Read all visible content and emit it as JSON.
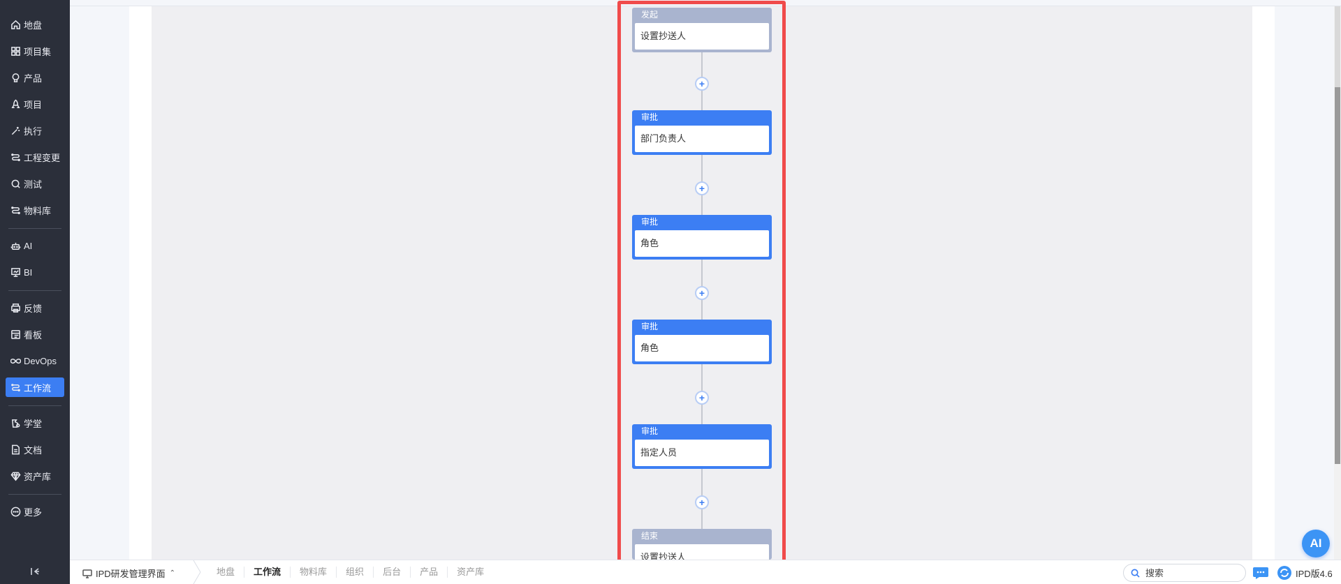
{
  "sidebar": {
    "items": [
      {
        "label": "地盘",
        "icon": "home-icon"
      },
      {
        "label": "项目集",
        "icon": "grid-icon"
      },
      {
        "label": "产品",
        "icon": "lightbulb-icon"
      },
      {
        "label": "项目",
        "icon": "rocket-icon"
      },
      {
        "label": "执行",
        "icon": "wand-icon"
      },
      {
        "label": "工程变更",
        "icon": "flow-icon"
      },
      {
        "label": "测试",
        "icon": "search-circle-icon"
      },
      {
        "label": "物料库",
        "icon": "flow-icon"
      },
      {
        "label": "AI",
        "icon": "robot-icon"
      },
      {
        "label": "BI",
        "icon": "chart-board-icon"
      },
      {
        "label": "反馈",
        "icon": "printer-icon"
      },
      {
        "label": "看板",
        "icon": "board-icon"
      },
      {
        "label": "DevOps",
        "icon": "infinity-icon"
      },
      {
        "label": "工作流",
        "icon": "flow-icon",
        "active": true
      },
      {
        "label": "学堂",
        "icon": "school-icon"
      },
      {
        "label": "文档",
        "icon": "document-icon"
      },
      {
        "label": "资产库",
        "icon": "diamond-icon"
      },
      {
        "label": "更多",
        "icon": "more-circle-icon"
      }
    ]
  },
  "flow": {
    "nodes": [
      {
        "type": "发起",
        "content": "设置抄送人",
        "style": "gray"
      },
      {
        "type": "审批",
        "content": "部门负责人",
        "style": "blue"
      },
      {
        "type": "审批",
        "content": "角色",
        "style": "blue"
      },
      {
        "type": "审批",
        "content": "角色",
        "style": "blue"
      },
      {
        "type": "审批",
        "content": "指定人员",
        "style": "blue"
      },
      {
        "type": "结束",
        "content": "设置抄送人",
        "style": "gray"
      }
    ],
    "add_symbol": "+"
  },
  "ai_button": {
    "label": "AI"
  },
  "bottombar": {
    "workspace": "IPD研发管理界面",
    "tabs": [
      "地盘",
      "工作流",
      "物料库",
      "组织",
      "后台",
      "产品",
      "资产库"
    ],
    "active_tab": "工作流",
    "search_placeholder": "搜索",
    "version": "IPD版4.6"
  },
  "colors": {
    "accent": "#3c7ef3",
    "sidebar_bg": "#2b2f3a",
    "highlight": "#f04b4b",
    "node_gray": "#a9b4cf"
  }
}
